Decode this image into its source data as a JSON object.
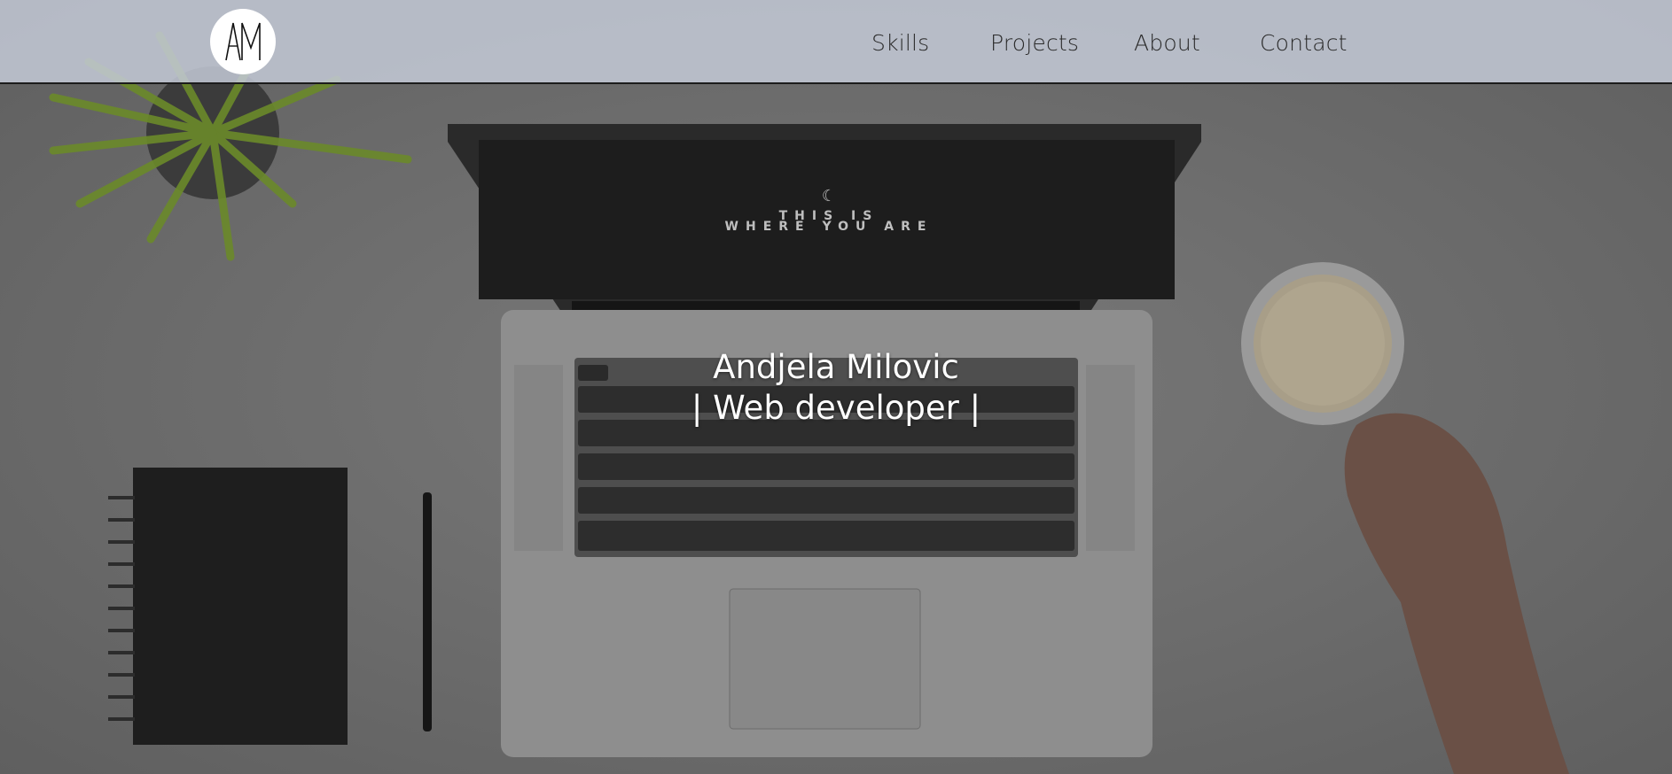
{
  "header": {
    "logo_text": "AM",
    "nav": [
      {
        "label": "Skills"
      },
      {
        "label": "Projects"
      },
      {
        "label": "About"
      },
      {
        "label": "Contact"
      }
    ]
  },
  "hero": {
    "name": "Andjela Milovic",
    "tagline": "| Web developer |",
    "screen_line1": "THIS IS",
    "screen_line2": "WHERE YOU ARE"
  },
  "colors": {
    "header_bg": "#c4cad6",
    "hero_overlay": "#6d6d6d",
    "text_light": "#ffffff",
    "nav_text": "#2b2b2b"
  }
}
